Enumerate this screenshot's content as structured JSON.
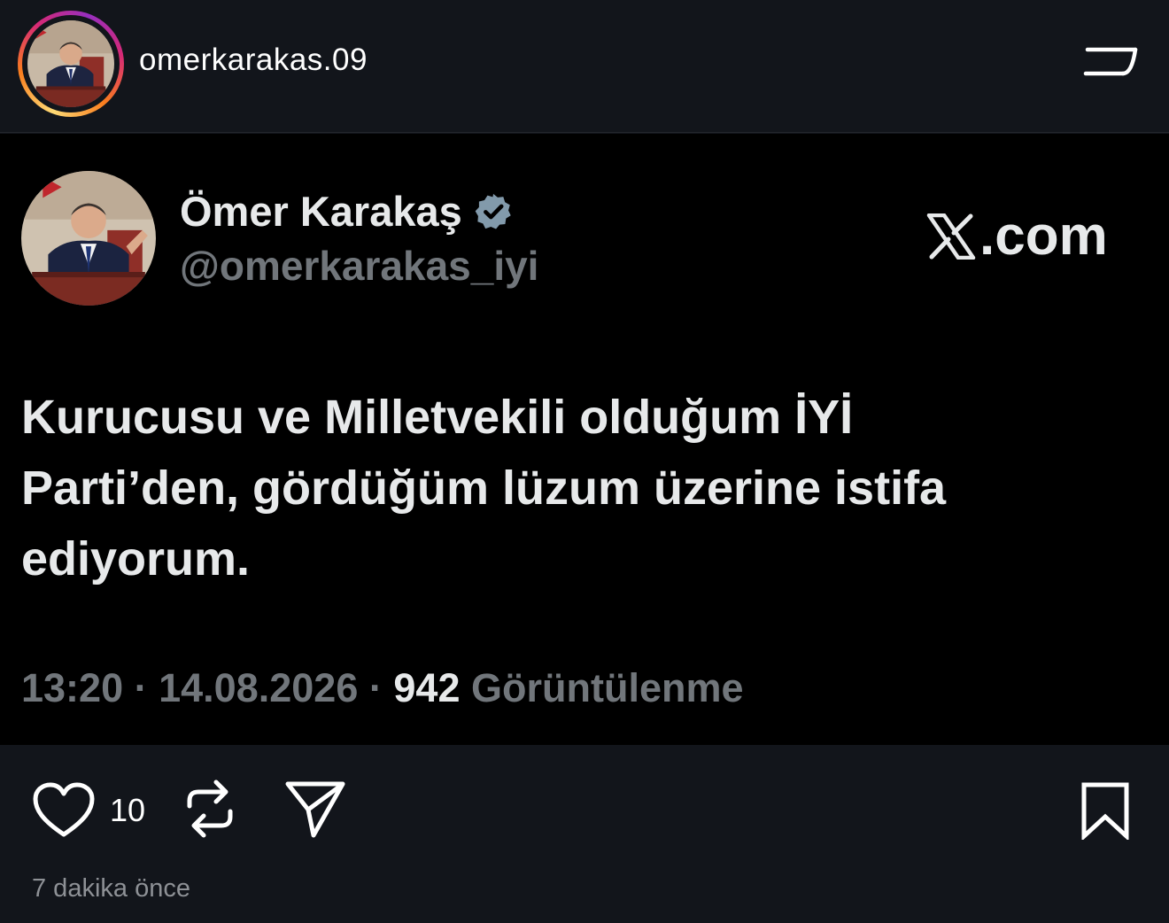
{
  "header": {
    "username": "omerkarakas.09",
    "menu_icon": "menu-icon"
  },
  "tweet": {
    "display_name": "Ömer Karakaş",
    "handle": "@omerkarakas_iyi",
    "verified_icon": "verified-icon",
    "source_label": ".com",
    "source_logo": "x-logo-icon",
    "text": "Kurucusu ve Milletvekili olduğum İYİ Parti’den, gördüğüm lüzum üzerine istifa ediyorum.",
    "time": "13:20",
    "date": "14.08.2026",
    "views_count": "942",
    "views_label": "Görüntülenme",
    "separator": "·"
  },
  "actions": {
    "like_icon": "heart-icon",
    "like_count": "10",
    "repost_icon": "repost-icon",
    "share_icon": "send-icon",
    "bookmark_icon": "bookmark-icon"
  },
  "post_time": "7 dakika önce",
  "colors": {
    "background": "#12151b",
    "tweet_background": "#000000",
    "tweet_text": "#e7e9ea",
    "tweet_muted": "#71767b",
    "verified": "#829aab"
  }
}
